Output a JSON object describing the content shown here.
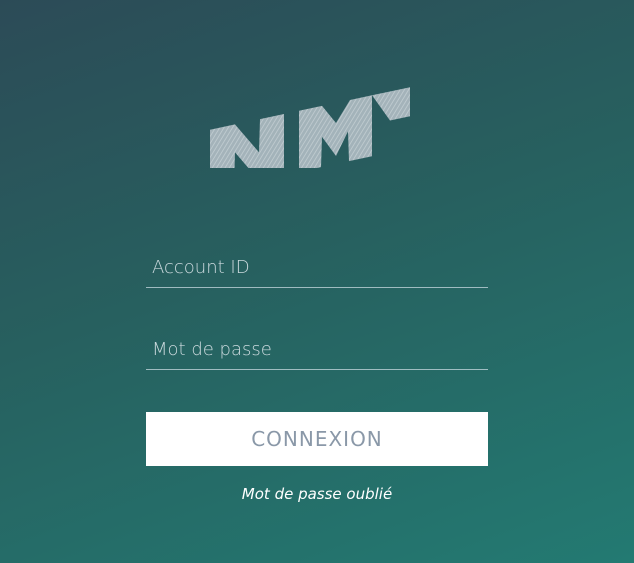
{
  "logo": {
    "icon": "nm-logo-icon",
    "color": "#b8c4ca"
  },
  "form": {
    "account_placeholder": "Account ID",
    "password_placeholder": "Mot de passe",
    "login_label": "CONNEXION",
    "forgot_label": "Mot de passe oublié"
  },
  "colors": {
    "background_top": "#2c4b57",
    "background_bottom": "#237a72",
    "button_background": "#ffffff",
    "button_text": "#8a98a8"
  }
}
